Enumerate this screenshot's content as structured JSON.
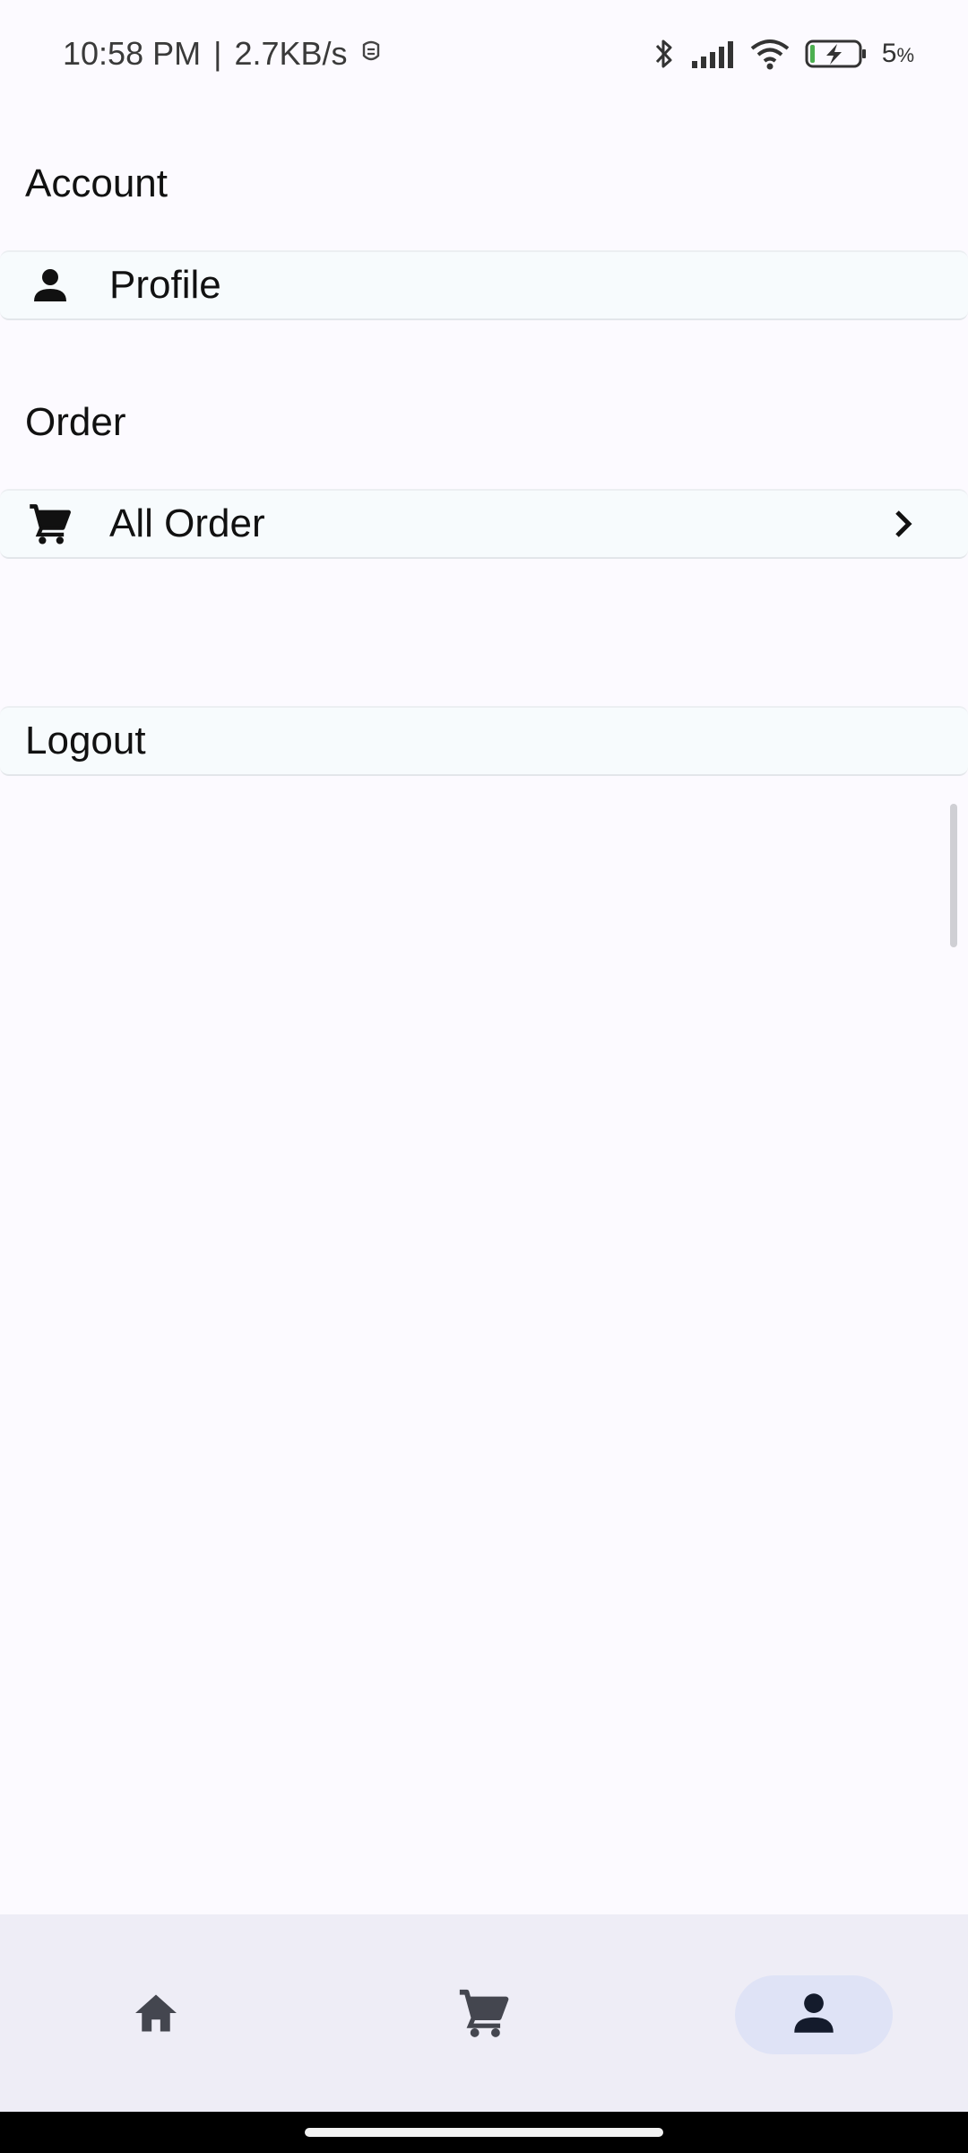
{
  "status_bar": {
    "time": "10:58 PM",
    "separator": "|",
    "network_speed": "2.7KB/s",
    "battery_percent": "5",
    "battery_percent_sign": "%",
    "icons": [
      "alarm-icon",
      "bluetooth-icon",
      "signal-icon",
      "wifi-icon",
      "battery-charging-icon"
    ]
  },
  "account": {
    "title": "Account",
    "items": [
      {
        "label": "Profile",
        "icon": "person-icon"
      }
    ]
  },
  "order": {
    "title": "Order",
    "items": [
      {
        "label": "All Order",
        "icon": "cart-icon",
        "trailing_icon": "chevron-right-icon"
      }
    ]
  },
  "logout": {
    "label": "Logout"
  },
  "bottom_nav": {
    "items": [
      {
        "name": "home",
        "icon": "home-icon",
        "active": false
      },
      {
        "name": "cart",
        "icon": "cart-icon",
        "active": false
      },
      {
        "name": "profile",
        "icon": "person-icon",
        "active": true
      }
    ],
    "active_color": "#dfe3f6",
    "background": "#eeedf6"
  },
  "colors": {
    "page_background": "#fcfaff",
    "row_background": "#f7fbfd",
    "icon_color": "#111111",
    "nav_icon_color": "#44464f"
  }
}
